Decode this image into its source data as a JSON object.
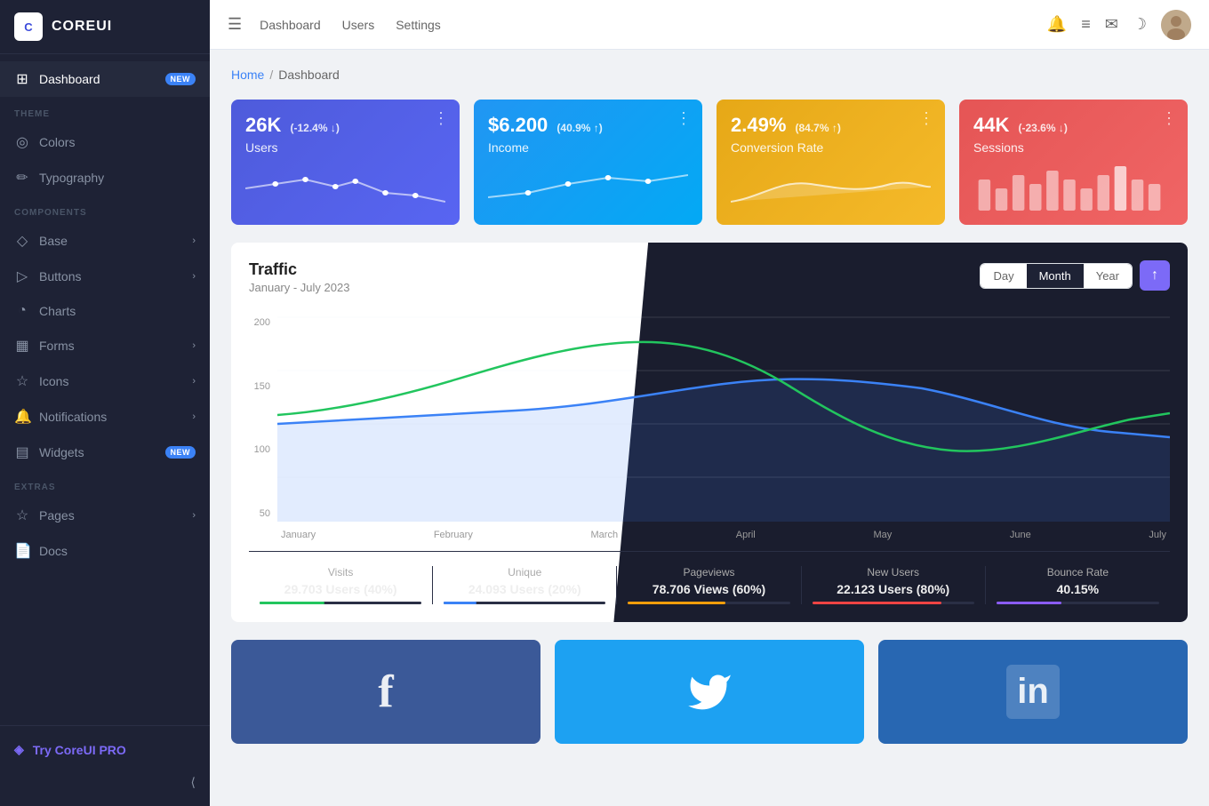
{
  "logo": {
    "icon": "C",
    "text": "COREUI"
  },
  "sidebar": {
    "dashboard_label": "Dashboard",
    "dashboard_badge": "NEW",
    "theme_section": "THEME",
    "colors_label": "Colors",
    "typography_label": "Typography",
    "components_section": "COMPONENTS",
    "base_label": "Base",
    "buttons_label": "Buttons",
    "charts_label": "Charts",
    "forms_label": "Forms",
    "icons_label": "Icons",
    "notifications_label": "Notifications",
    "widgets_label": "Widgets",
    "widgets_badge": "NEW",
    "extras_section": "EXTRAS",
    "pages_label": "Pages",
    "docs_label": "Docs",
    "try_pro_label": "Try CoreUI PRO"
  },
  "header": {
    "nav": [
      "Dashboard",
      "Users",
      "Settings"
    ],
    "day_label": "Day",
    "month_label": "Month",
    "year_label": "Year"
  },
  "breadcrumb": {
    "home": "Home",
    "separator": "/",
    "current": "Dashboard"
  },
  "stats": [
    {
      "value": "26K",
      "change": "(-12.4% ↓)",
      "label": "Users",
      "color": "blue"
    },
    {
      "value": "$6.200",
      "change": "(40.9% ↑)",
      "label": "Income",
      "color": "cyan"
    },
    {
      "value": "2.49%",
      "change": "(84.7% ↑)",
      "label": "Conversion Rate",
      "color": "yellow"
    },
    {
      "value": "44K",
      "change": "(-23.6% ↓)",
      "label": "Sessions",
      "color": "red"
    }
  ],
  "traffic": {
    "title": "Traffic",
    "subtitle": "January - July 2023",
    "buttons": [
      "Day",
      "Month",
      "Year"
    ],
    "active_button": "Month",
    "y_labels": [
      "200",
      "150",
      "100",
      "50"
    ],
    "x_labels": [
      "January",
      "February",
      "March",
      "April",
      "May",
      "June",
      "July"
    ]
  },
  "traffic_stats": [
    {
      "label": "Visits",
      "value": "29.703 Users (40%)",
      "pct": 40,
      "color": "green"
    },
    {
      "label": "Unique",
      "value": "24.093 Users (20%)",
      "pct": 20,
      "color": "blue"
    },
    {
      "label": "Pageviews",
      "value": "78.706 Views (60%)",
      "pct": 60,
      "color": "yellow"
    },
    {
      "label": "New Users",
      "value": "22.123 Users (80%)",
      "pct": 80,
      "color": "red"
    },
    {
      "label": "Bounce Rate",
      "value": "40.15%",
      "pct": 40,
      "color": "purple"
    }
  ],
  "social": [
    {
      "name": "Facebook",
      "icon": "f",
      "color": "facebook"
    },
    {
      "name": "Twitter",
      "icon": "🐦",
      "color": "twitter"
    },
    {
      "name": "LinkedIn",
      "icon": "in",
      "color": "linkedin"
    }
  ]
}
